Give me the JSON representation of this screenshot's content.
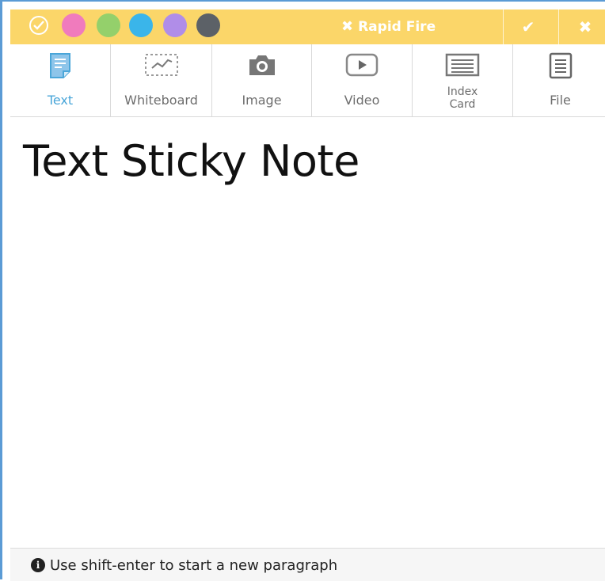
{
  "topbar": {
    "rapid_fire_label": "Rapid Fire",
    "colors": {
      "bar": "#fbd669",
      "pink": "#f07bbd",
      "green": "#94d06b",
      "blue": "#3ab5ea",
      "purple": "#b08de8",
      "gray": "#5c6167"
    }
  },
  "tabs": [
    {
      "label": "Text",
      "icon": "text-note-icon"
    },
    {
      "label": "Whiteboard",
      "icon": "whiteboard-icon"
    },
    {
      "label": "Image",
      "icon": "camera-icon"
    },
    {
      "label": "Video",
      "icon": "play-icon"
    },
    {
      "label_line1": "Index",
      "label_line2": "Card",
      "icon": "index-card-icon"
    },
    {
      "label": "File",
      "icon": "file-icon"
    }
  ],
  "active_tab": "Text",
  "accent": "#4aa6d9",
  "note": {
    "title": "Text Sticky Note"
  },
  "footer": {
    "hint": "Use shift-enter to start a new paragraph"
  }
}
